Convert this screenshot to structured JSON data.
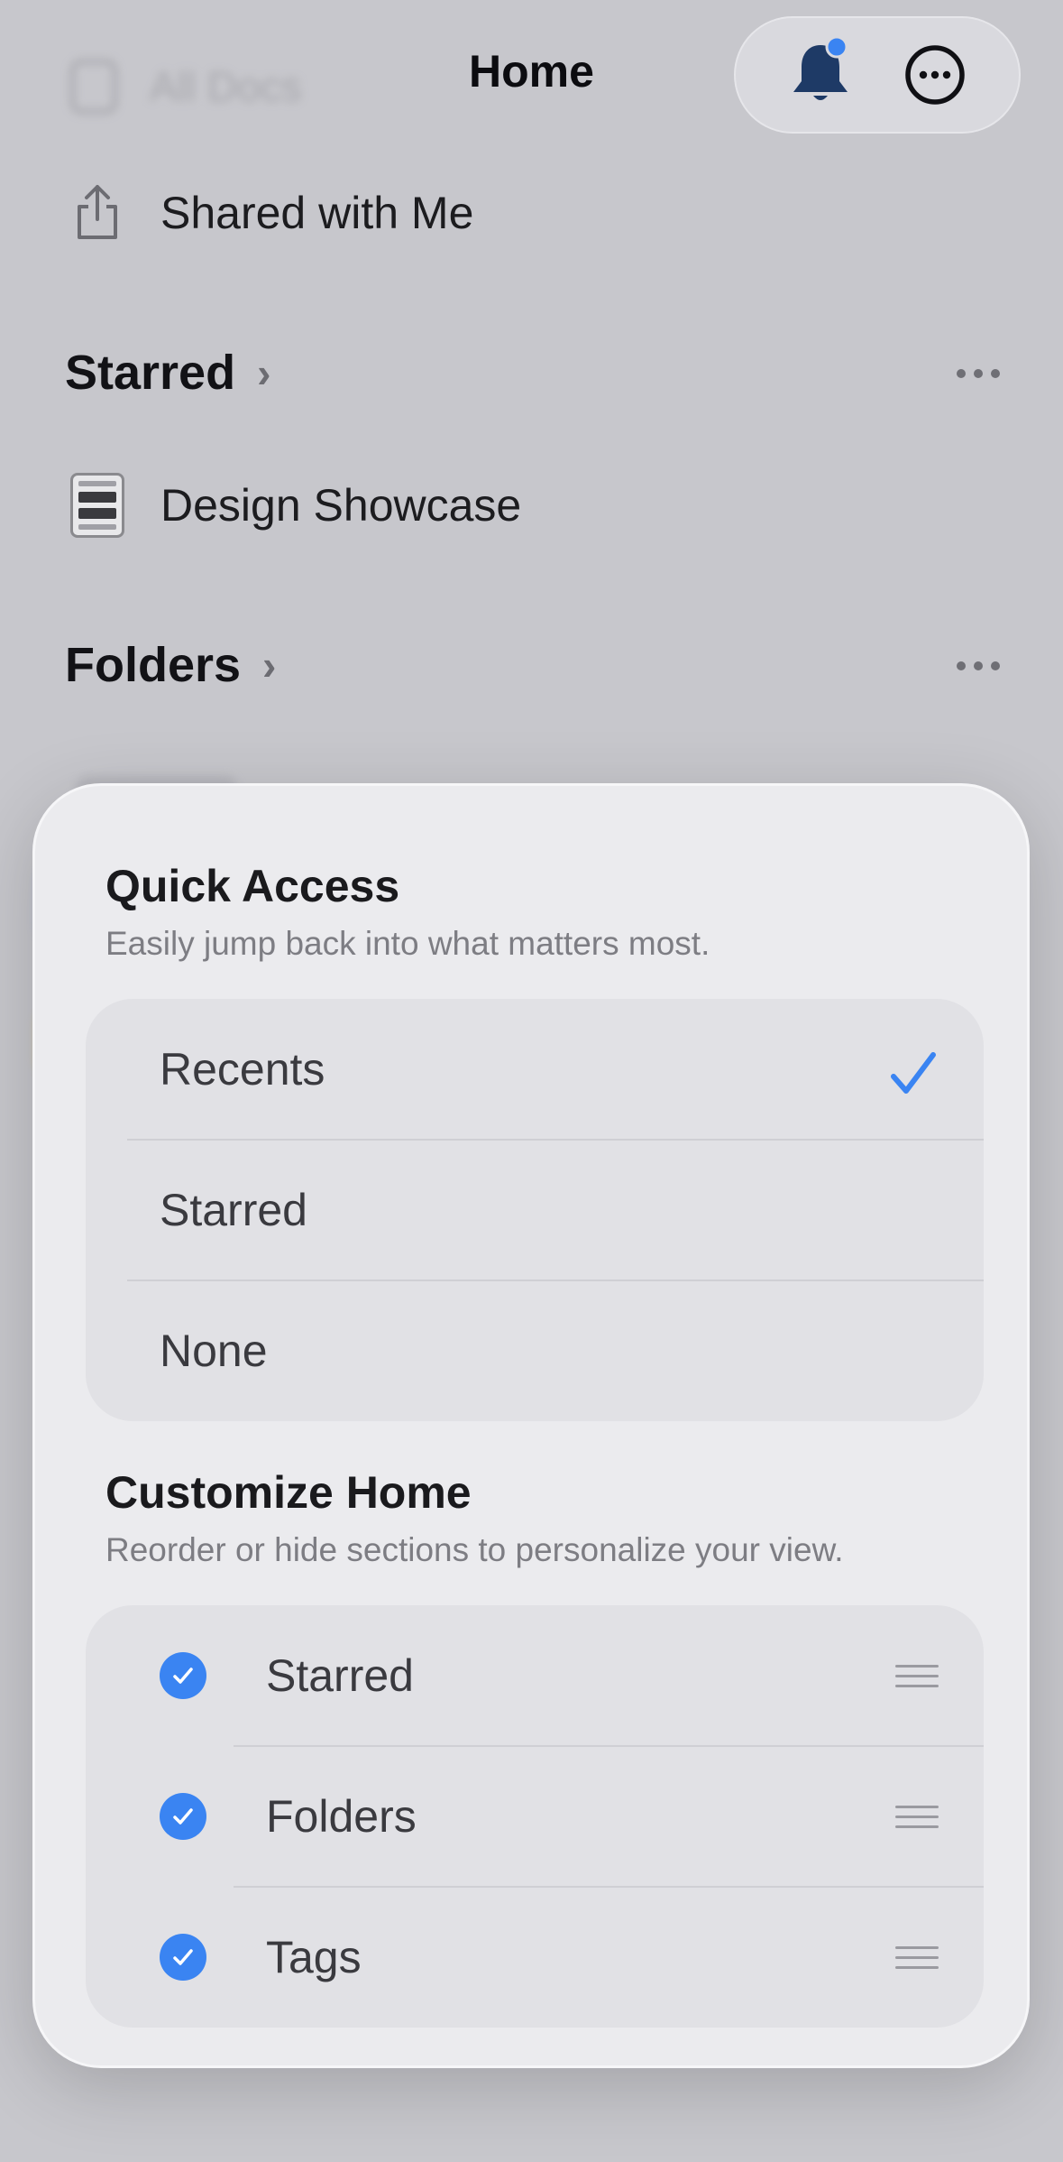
{
  "header": {
    "title": "Home",
    "ghost_item": "All Docs",
    "notification_icon": "bell-icon",
    "more_icon": "ellipsis-circle-icon",
    "accent": "#3a84f2",
    "bell_color": "#1e3a66"
  },
  "home": {
    "shared_with_me": "Shared with Me",
    "starred_section": "Starred",
    "starred_doc": "Design Showcase",
    "folders_section": "Folders"
  },
  "sheet": {
    "quick_access": {
      "title": "Quick Access",
      "subtitle": "Easily jump back into what matters most.",
      "options": [
        {
          "label": "Recents",
          "selected": true
        },
        {
          "label": "Starred",
          "selected": false
        },
        {
          "label": "None",
          "selected": false
        }
      ]
    },
    "customize": {
      "title": "Customize Home",
      "subtitle": "Reorder or hide sections to personalize your view.",
      "items": [
        {
          "label": "Starred",
          "checked": true
        },
        {
          "label": "Folders",
          "checked": true
        },
        {
          "label": "Tags",
          "checked": true
        }
      ]
    }
  }
}
